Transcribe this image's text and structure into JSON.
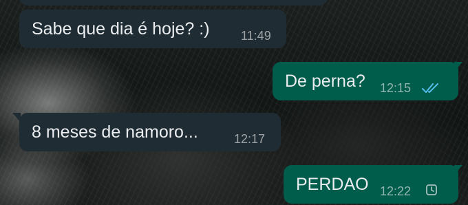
{
  "chat": {
    "messages": [
      {
        "direction": "incoming",
        "text": "Sabe que dia é hoje? :)",
        "time": "11:49"
      },
      {
        "direction": "outgoing",
        "text": "De perna?",
        "time": "12:15",
        "status_icon": "double-check-read-icon"
      },
      {
        "direction": "incoming",
        "text": "8 meses de namoro...",
        "time": "12:17"
      },
      {
        "direction": "outgoing",
        "text": "PERDAO",
        "time": "12:22",
        "status_icon": "clock-pending-icon"
      }
    ]
  },
  "colors": {
    "incoming_bubble": "#202c33",
    "outgoing_bubble": "#005c4b",
    "text": "#e9edef",
    "read_ticks": "#53bdeb"
  }
}
